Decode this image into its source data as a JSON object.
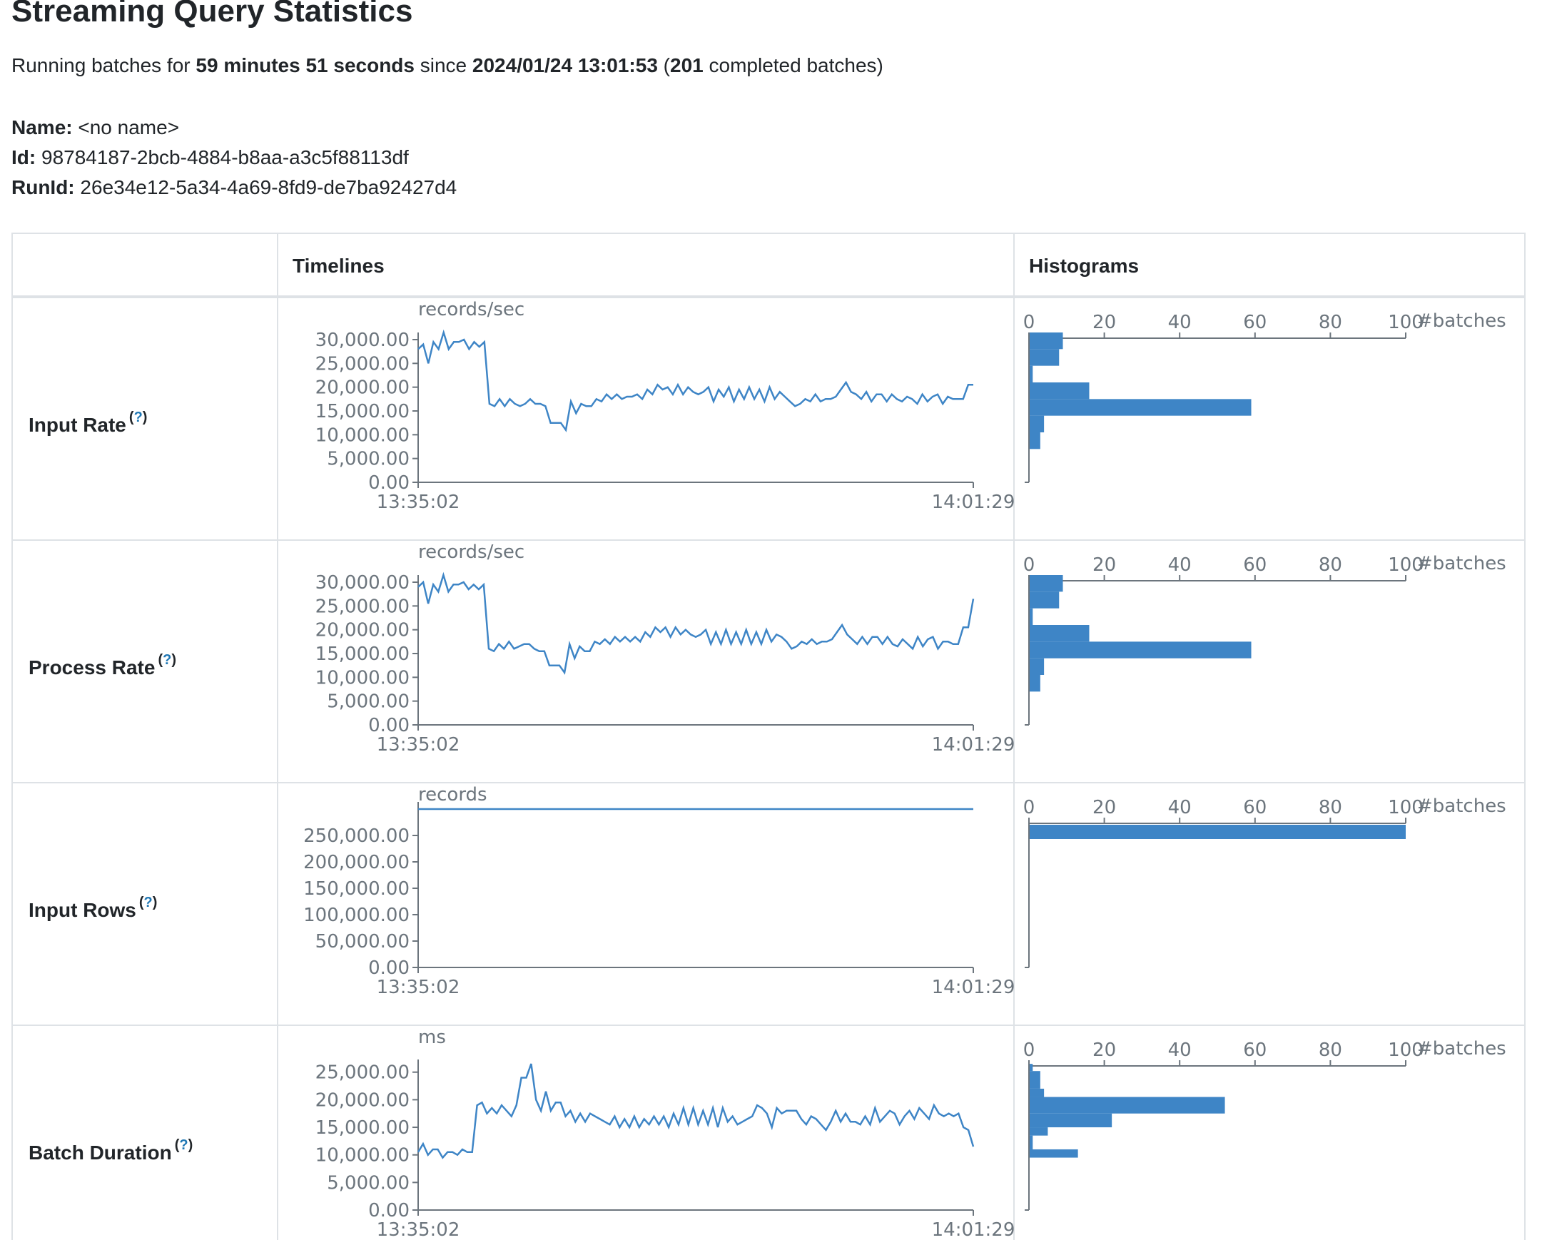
{
  "page": {
    "title": "Streaming Query Statistics",
    "summary": {
      "prefix": "Running batches for ",
      "duration": "59 minutes 51 seconds",
      "since_text": " since ",
      "start_time": "2024/01/24 13:01:53",
      "open_paren": " (",
      "completed_count": "201",
      "suffix": " completed batches)"
    },
    "info": {
      "name_label": "Name:",
      "name_value": "<no name>",
      "id_label": "Id:",
      "id_value": "98784187-2bcb-4884-b8aa-a3c5f88113df",
      "runid_label": "RunId:",
      "runid_value": "26e34e12-5a34-4a69-8fd9-de7ba92427d4"
    }
  },
  "table": {
    "headers": {
      "timelines": "Timelines",
      "histograms": "Histograms"
    },
    "help_open": "(",
    "help_mark": "?",
    "help_close": ")"
  },
  "colors": {
    "series": "#3e85c6",
    "axis": "#6c757d",
    "text": "#212529",
    "border": "#dee2e6",
    "help": "#1f77b4"
  },
  "chart_data": [
    {
      "type": "line",
      "row_label": "Input Rate",
      "unit_label": "records/sec",
      "x_start": "13:35:02",
      "x_end": "14:01:29",
      "ylim": [
        0,
        30000
      ],
      "yticks": [
        0,
        5000,
        10000,
        15000,
        20000,
        25000,
        30000
      ],
      "ytick_labels": [
        "0.00",
        "5,000.00",
        "10,000.00",
        "15,000.00",
        "20,000.00",
        "25,000.00",
        "30,000.00"
      ],
      "values": [
        28000,
        29000,
        25000,
        29500,
        28000,
        31500,
        28000,
        29500,
        29500,
        30000,
        28000,
        29500,
        28500,
        29500,
        16500,
        16000,
        17500,
        16000,
        17500,
        16500,
        16000,
        16500,
        17500,
        16500,
        16500,
        16000,
        12500,
        12500,
        12500,
        11000,
        17000,
        14500,
        16500,
        16000,
        16000,
        17500,
        17000,
        18500,
        17500,
        18500,
        17500,
        18000,
        18000,
        18500,
        17500,
        19500,
        18500,
        20500,
        19500,
        20000,
        18500,
        20500,
        18500,
        20000,
        19000,
        18500,
        19000,
        20000,
        17000,
        19500,
        18000,
        20000,
        17000,
        19500,
        17500,
        20000,
        17500,
        19500,
        17000,
        20000,
        17500,
        19000,
        18000,
        17000,
        16000,
        16500,
        17500,
        17000,
        18500,
        17000,
        17500,
        17500,
        18000,
        19500,
        21000,
        19000,
        18500,
        17500,
        19000,
        17000,
        18500,
        18500,
        17000,
        18500,
        17500,
        17000,
        18000,
        17500,
        16500,
        18500,
        17000,
        18000,
        18500,
        16500,
        18000,
        17500,
        17500,
        17500,
        20500,
        20500
      ],
      "histogram": {
        "xlim": [
          0,
          100
        ],
        "xticks": [
          0,
          20,
          40,
          60,
          80,
          100
        ],
        "x_label": "#batches",
        "bins": [
          {
            "low": 28000,
            "high": 31500,
            "count": 9
          },
          {
            "low": 24500,
            "high": 28000,
            "count": 8
          },
          {
            "low": 21000,
            "high": 24500,
            "count": 1
          },
          {
            "low": 17500,
            "high": 21000,
            "count": 16
          },
          {
            "low": 14000,
            "high": 17500,
            "count": 59
          },
          {
            "low": 10500,
            "high": 14000,
            "count": 4
          },
          {
            "low": 7000,
            "high": 10500,
            "count": 3
          }
        ]
      }
    },
    {
      "type": "line",
      "row_label": "Process Rate",
      "unit_label": "records/sec",
      "x_start": "13:35:02",
      "x_end": "14:01:29",
      "ylim": [
        0,
        30000
      ],
      "yticks": [
        0,
        5000,
        10000,
        15000,
        20000,
        25000,
        30000
      ],
      "ytick_labels": [
        "0.00",
        "5,000.00",
        "10,000.00",
        "15,000.00",
        "20,000.00",
        "25,000.00",
        "30,000.00"
      ],
      "values": [
        29000,
        30000,
        25500,
        29500,
        28000,
        31500,
        28000,
        29500,
        29500,
        30000,
        28500,
        29500,
        28500,
        29500,
        16000,
        15500,
        17000,
        16000,
        17500,
        16000,
        16500,
        17000,
        17000,
        16000,
        15500,
        15500,
        12500,
        12500,
        12500,
        11000,
        17000,
        14000,
        16500,
        15500,
        15500,
        17500,
        17000,
        18000,
        17000,
        18500,
        17500,
        18500,
        17500,
        18500,
        17500,
        19500,
        18500,
        20500,
        19500,
        20500,
        18500,
        20500,
        19000,
        20000,
        19000,
        18500,
        19000,
        20000,
        17000,
        19500,
        17000,
        20000,
        17000,
        19500,
        17000,
        20000,
        17000,
        19500,
        17000,
        20000,
        17500,
        19000,
        18500,
        17500,
        16000,
        16500,
        17500,
        17000,
        18000,
        17000,
        17500,
        17500,
        18000,
        19500,
        21000,
        19000,
        18000,
        17000,
        18500,
        17000,
        18500,
        18500,
        17000,
        18500,
        17000,
        16500,
        18000,
        17000,
        16000,
        18500,
        16500,
        18000,
        18500,
        16000,
        17500,
        17500,
        17000,
        17000,
        20500,
        20500,
        26500
      ],
      "histogram": {
        "xlim": [
          0,
          100
        ],
        "xticks": [
          0,
          20,
          40,
          60,
          80,
          100
        ],
        "x_label": "#batches",
        "bins": [
          {
            "low": 28000,
            "high": 31500,
            "count": 9
          },
          {
            "low": 24500,
            "high": 28000,
            "count": 8
          },
          {
            "low": 21000,
            "high": 24500,
            "count": 1
          },
          {
            "low": 17500,
            "high": 21000,
            "count": 16
          },
          {
            "low": 14000,
            "high": 17500,
            "count": 59
          },
          {
            "low": 10500,
            "high": 14000,
            "count": 4
          },
          {
            "low": 7000,
            "high": 10500,
            "count": 3
          }
        ]
      }
    },
    {
      "type": "line",
      "row_label": "Input Rows",
      "unit_label": "records",
      "x_start": "13:35:02",
      "x_end": "14:01:29",
      "ylim": [
        0,
        300000
      ],
      "yticks": [
        0,
        50000,
        100000,
        150000,
        200000,
        250000
      ],
      "ytick_labels": [
        "0.00",
        "50,000.00",
        "100,000.00",
        "150,000.00",
        "200,000.00",
        "250,000.00"
      ],
      "values": [
        300000,
        300000
      ],
      "histogram": {
        "xlim": [
          0,
          100
        ],
        "xticks": [
          0,
          20,
          40,
          60,
          80,
          100
        ],
        "x_label": "#batches",
        "bins": [
          {
            "low": 300000,
            "high": 300000,
            "count": 100
          }
        ],
        "bar_half_height_units": 8000
      }
    },
    {
      "type": "line",
      "row_label": "Batch Duration",
      "unit_label": "ms",
      "x_start": "13:35:02",
      "x_end": "14:01:29",
      "ylim": [
        0,
        26000
      ],
      "yticks": [
        0,
        5000,
        10000,
        15000,
        20000,
        25000
      ],
      "ytick_labels": [
        "0.00",
        "5,000.00",
        "10,000.00",
        "15,000.00",
        "20,000.00",
        "25,000.00"
      ],
      "values": [
        10500,
        12000,
        10000,
        11000,
        11000,
        9500,
        10500,
        10500,
        10000,
        11000,
        10500,
        10500,
        19000,
        19500,
        17500,
        18500,
        17500,
        19000,
        18000,
        17000,
        19000,
        24000,
        24000,
        26500,
        20000,
        18000,
        21500,
        18000,
        19500,
        19500,
        17000,
        18000,
        16000,
        17500,
        16000,
        17500,
        17000,
        16500,
        16000,
        15500,
        17000,
        15000,
        16500,
        15000,
        17000,
        15000,
        16500,
        15500,
        17000,
        15500,
        17000,
        15000,
        17500,
        15500,
        18500,
        15500,
        18500,
        15500,
        18000,
        15500,
        18500,
        15000,
        18500,
        16000,
        17000,
        15500,
        16000,
        16500,
        17000,
        19000,
        18500,
        17500,
        15000,
        18500,
        17500,
        18000,
        18000,
        18000,
        16500,
        15500,
        17000,
        16500,
        15500,
        14500,
        16000,
        18000,
        16000,
        17500,
        16000,
        16000,
        15500,
        17000,
        15500,
        18500,
        16000,
        17000,
        18000,
        17500,
        15500,
        17000,
        18000,
        16500,
        18500,
        17500,
        16500,
        19000,
        17500,
        17000,
        17500,
        17000,
        17500,
        15000,
        14500,
        11500
      ],
      "histogram": {
        "xlim": [
          0,
          100
        ],
        "xticks": [
          0,
          20,
          40,
          60,
          80,
          100
        ],
        "x_label": "#batches",
        "bins": [
          {
            "low": 25200,
            "high": 26500,
            "count": 1
          },
          {
            "low": 22000,
            "high": 25200,
            "count": 3
          },
          {
            "low": 20500,
            "high": 22000,
            "count": 4
          },
          {
            "low": 17500,
            "high": 20500,
            "count": 52
          },
          {
            "low": 15000,
            "high": 17500,
            "count": 22
          },
          {
            "low": 13500,
            "high": 15000,
            "count": 5
          },
          {
            "low": 11000,
            "high": 13500,
            "count": 1
          },
          {
            "low": 9500,
            "high": 11000,
            "count": 13
          }
        ]
      }
    }
  ]
}
